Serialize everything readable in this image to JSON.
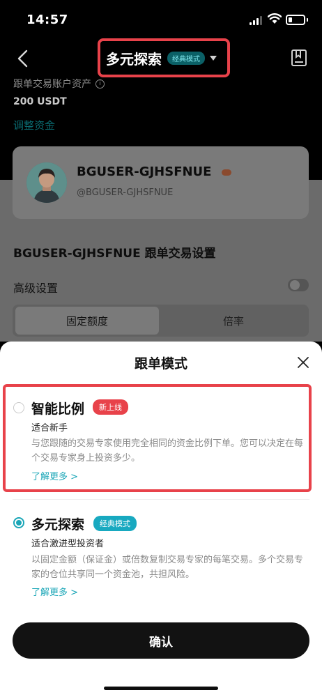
{
  "status_bar": {
    "time": "14:57"
  },
  "header": {
    "title": "多元探索",
    "mode_badge": "经典模式"
  },
  "background": {
    "asset_label": "跟单交易账户资产",
    "asset_value": "200 USDT",
    "adjust_link": "调整资金",
    "profile_name": "BGUSER-GJHSFNUE",
    "profile_handle": "@BGUSER-GJHSFNUE",
    "settings_title": "BGUSER-GJHSFNUE 跟单交易设置",
    "advanced_label": "高级设置",
    "tabs": [
      {
        "label": "固定额度"
      },
      {
        "label": "倍率"
      }
    ]
  },
  "sheet": {
    "title": "跟单模式",
    "options": [
      {
        "title": "智能比例",
        "badge": "新上线",
        "subtitle": "适合新手",
        "description": "与您跟随的交易专家使用完全相同的资金比例下单。您可以决定在每个交易专家身上投资多少。",
        "learn_more": "了解更多 >",
        "selected": false
      },
      {
        "title": "多元探索",
        "badge": "经典模式",
        "subtitle": "适合激进型投资者",
        "description": "以固定金额（保证金）或倍数复制交易专家的每笔交易。多个交易专家的仓位共享同一个资金池，共担风险。",
        "learn_more": "了解更多 >",
        "selected": true
      }
    ],
    "confirm_label": "确认"
  },
  "colors": {
    "highlight_red": "#e8424a",
    "accent_teal": "#1aa6b7"
  }
}
